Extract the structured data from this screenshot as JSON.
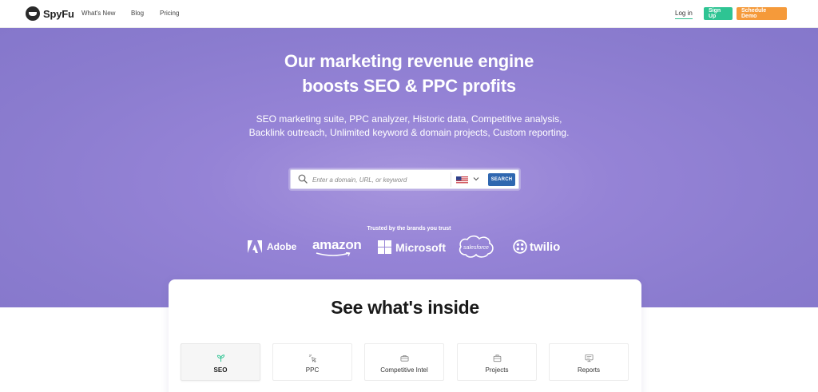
{
  "nav": {
    "logo_text": "SpyFu",
    "links": [
      "What's New",
      "Blog",
      "Pricing"
    ],
    "login": "Log in",
    "signup": "Sign Up",
    "schedule_demo": "Schedule Demo",
    "colors": {
      "signup": "#2ec493",
      "demo": "#f59a3a"
    }
  },
  "hero": {
    "title_line1": "Our marketing revenue engine",
    "title_line2": "boosts SEO & PPC profits",
    "subtitle": "SEO marketing suite, PPC analyzer, Historic data, Competitive analysis, Backlink outreach, Unlimited keyword & domain projects, Custom reporting.",
    "search": {
      "placeholder": "Enter a domain, URL, or keyword",
      "country_icon": "us-flag-icon",
      "button": "SEARCH"
    },
    "trusted_label": "Trusted by the brands you trust",
    "brands": [
      "Adobe",
      "amazon",
      "Microsoft",
      "salesforce",
      "twilio"
    ]
  },
  "inside": {
    "title": "See what's inside",
    "tabs": [
      {
        "label": "SEO",
        "icon": "sprout-icon",
        "active": true
      },
      {
        "label": "PPC",
        "icon": "cursor-click-icon",
        "active": false
      },
      {
        "label": "Competitive Intel",
        "icon": "briefcase-icon",
        "active": false
      },
      {
        "label": "Projects",
        "icon": "suitcase-icon",
        "active": false
      },
      {
        "label": "Reports",
        "icon": "monitor-icon",
        "active": false
      }
    ]
  }
}
